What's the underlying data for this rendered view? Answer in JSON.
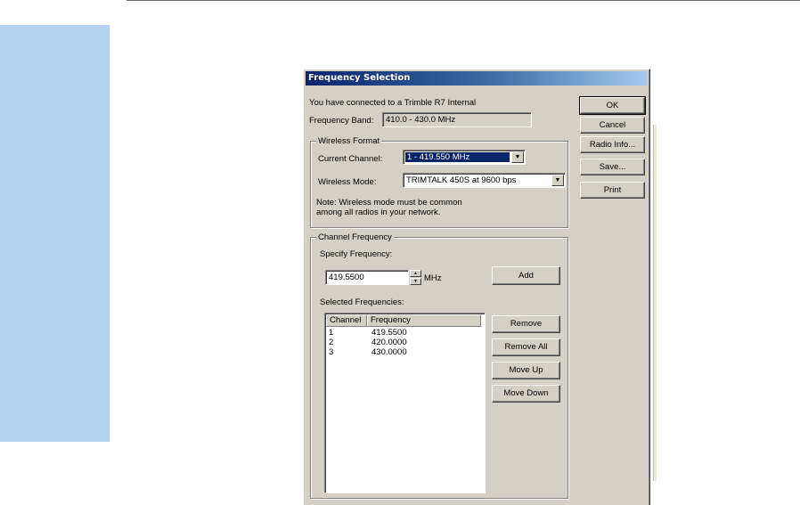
{
  "dialog": {
    "title": "Frequency Selection",
    "connected_text": "You have connected to a Trimble R7 Internal",
    "frequency_band_label": "Frequency Band:",
    "frequency_band_value": "410.0 - 430.0 MHz",
    "buttons": {
      "ok": "OK",
      "cancel": "Cancel",
      "radio_info": "Radio Info...",
      "save": "Save...",
      "print": "Print"
    },
    "wireless_format": {
      "title": "Wireless Format",
      "current_channel_label": "Current Channel:",
      "current_channel_value": "1 - 419.550 MHz",
      "wireless_mode_label": "Wireless Mode:",
      "wireless_mode_value": "TRIMTALK 450S at 9600 bps",
      "note_line1": "Note: Wireless mode must be common",
      "note_line2": "among all radios in your network."
    },
    "channel_frequency": {
      "title": "Channel Frequency",
      "specify_label": "Specify Frequency:",
      "frequency_value": "419.5500",
      "unit": "MHz",
      "add_button": "Add",
      "selected_label": "Selected Frequencies:",
      "columns": [
        "Channel",
        "Frequency"
      ],
      "rows": [
        {
          "channel": "1",
          "frequency": "419.5500"
        },
        {
          "channel": "2",
          "frequency": "420.0000"
        },
        {
          "channel": "3",
          "frequency": "430.0000"
        }
      ],
      "remove_button": "Remove",
      "remove_all_button": "Remove All",
      "move_up_button": "Move Up",
      "move_down_button": "Move Down"
    }
  },
  "colors": {
    "side_panel": "#b4d3f0",
    "dialog_face": "#d4d0c8",
    "title_start": "#0a246a",
    "selection": "#0a246a"
  },
  "icons": {
    "dropdown": "chevron-down-icon",
    "spin_up": "spin-up-icon",
    "spin_down": "spin-down-icon"
  }
}
